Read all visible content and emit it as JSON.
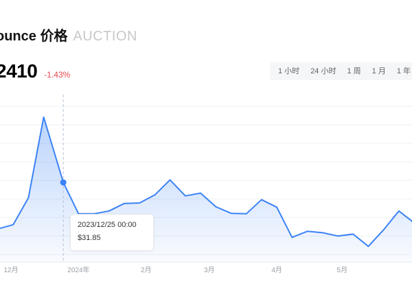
{
  "header": {
    "title": "ounce 价格",
    "ticker": "AUCTION"
  },
  "price": {
    "value": "2410",
    "change": "-1.43%",
    "change_color": "#e5484d"
  },
  "range_tabs": [
    {
      "label": "1 小时"
    },
    {
      "label": "24 小时"
    },
    {
      "label": "1 周"
    },
    {
      "label": "1 月"
    },
    {
      "label": "1 年"
    }
  ],
  "tooltip": {
    "date": "2023/12/25 00:00",
    "value": "$31.85"
  },
  "colors": {
    "line": "#3b82f6",
    "fill": "#3b82f6",
    "crosshair": "#b8c4d4"
  },
  "chart_data": {
    "type": "area",
    "x_tick_labels": [
      "12月",
      "2024年",
      "2月",
      "3月",
      "4月",
      "5月"
    ],
    "x": [
      "2023-11-25",
      "2023-12-02",
      "2023-12-09",
      "2023-12-16",
      "2023-12-25",
      "2024-01-01",
      "2024-01-08",
      "2024-01-15",
      "2024-01-22",
      "2024-01-29",
      "2024-02-05",
      "2024-02-12",
      "2024-02-19",
      "2024-02-26",
      "2024-03-04",
      "2024-03-11",
      "2024-03-18",
      "2024-03-25",
      "2024-04-01",
      "2024-04-08",
      "2024-04-15",
      "2024-04-22",
      "2024-04-29",
      "2024-05-06",
      "2024-05-13",
      "2024-05-20",
      "2024-05-27",
      "2024-06-03"
    ],
    "values": [
      22.0,
      22.9,
      28.6,
      45.7,
      31.85,
      25.2,
      25.2,
      25.8,
      27.4,
      27.5,
      29.2,
      32.4,
      29.0,
      29.6,
      26.7,
      25.3,
      25.2,
      28.2,
      26.6,
      20.2,
      21.5,
      21.2,
      20.5,
      20.9,
      18.3,
      21.8,
      25.8,
      23.3
    ],
    "highlight_index": 4,
    "grid": true
  }
}
